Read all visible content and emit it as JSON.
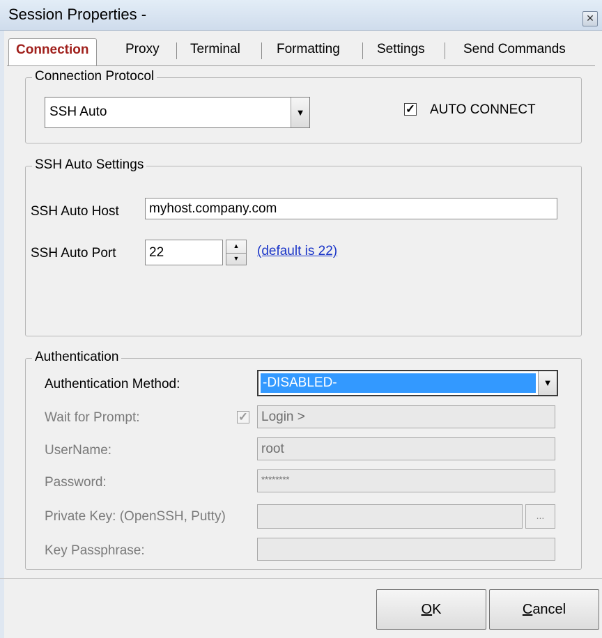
{
  "window": {
    "title": "Session Properties -"
  },
  "tabs": [
    {
      "label": "Connection"
    },
    {
      "label": "Proxy"
    },
    {
      "label": "Terminal"
    },
    {
      "label": "Formatting"
    },
    {
      "label": "Settings"
    },
    {
      "label": "Send Commands"
    }
  ],
  "connection_protocol": {
    "legend": "Connection Protocol",
    "protocol_value": "SSH Auto",
    "auto_connect_label": "AUTO CONNECT",
    "auto_connect_checked": true
  },
  "ssh_settings": {
    "legend": "SSH Auto Settings",
    "host_label": "SSH Auto Host",
    "host_value": "myhost.company.com",
    "port_label": "SSH Auto Port",
    "port_value": "22",
    "default_link": "(default is 22)"
  },
  "authentication": {
    "legend": "Authentication",
    "method_label": "Authentication Method:",
    "method_value": "-DISABLED-",
    "wait_label": "Wait for Prompt:",
    "wait_checked": true,
    "wait_value": "Login >",
    "username_label": "UserName:",
    "username_value": "root",
    "password_label": "Password:",
    "password_value": "********",
    "private_key_label": "Private Key: (OpenSSH, Putty)",
    "private_key_value": "",
    "browse_label": "...",
    "passphrase_label": "Key Passphrase:",
    "passphrase_value": ""
  },
  "buttons": {
    "ok_mnemonic": "O",
    "ok_rest": "K",
    "cancel_mnemonic": "C",
    "cancel_rest": "ancel"
  },
  "colors": {
    "active_tab": "#a0201c",
    "link": "#1a35c8",
    "selection": "#3399ff"
  }
}
